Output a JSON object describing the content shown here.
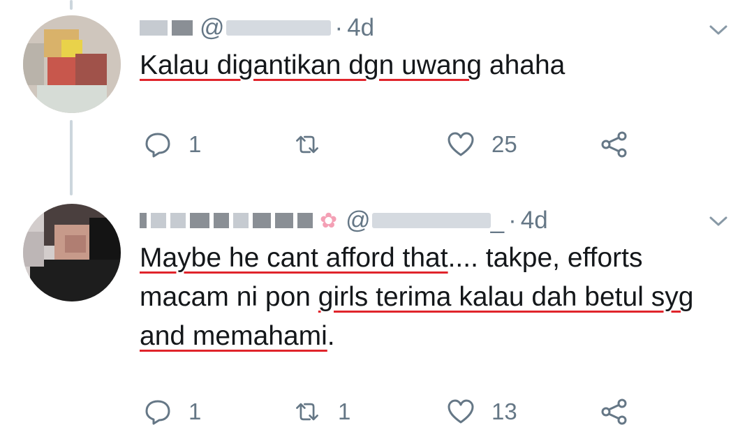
{
  "tweets": [
    {
      "handle_prefix": "@",
      "time_sep": "·",
      "time": "4d",
      "text_parts": [
        "Kalau digantikan dgn uwang",
        " ahaha"
      ],
      "reply_count": "1",
      "retweet_count": "",
      "like_count": "25"
    },
    {
      "handle_prefix": "@",
      "handle_suffix": "_",
      "time_sep": "·",
      "time": "4d",
      "text_parts": [
        "Maybe he cant afford that",
        ".... takpe, efforts macam ni pon ",
        "girls terima kalau dah betul syg and memahami",
        "."
      ],
      "reply_count": "1",
      "retweet_count": "1",
      "like_count": "13"
    }
  ],
  "colors": {
    "text": "#14171a",
    "muted": "#657786",
    "underline": "#e0242b",
    "thread_line": "#ccd6dd"
  },
  "icons": [
    "reply-icon",
    "retweet-icon",
    "like-icon",
    "share-icon",
    "chevron-down-icon"
  ]
}
